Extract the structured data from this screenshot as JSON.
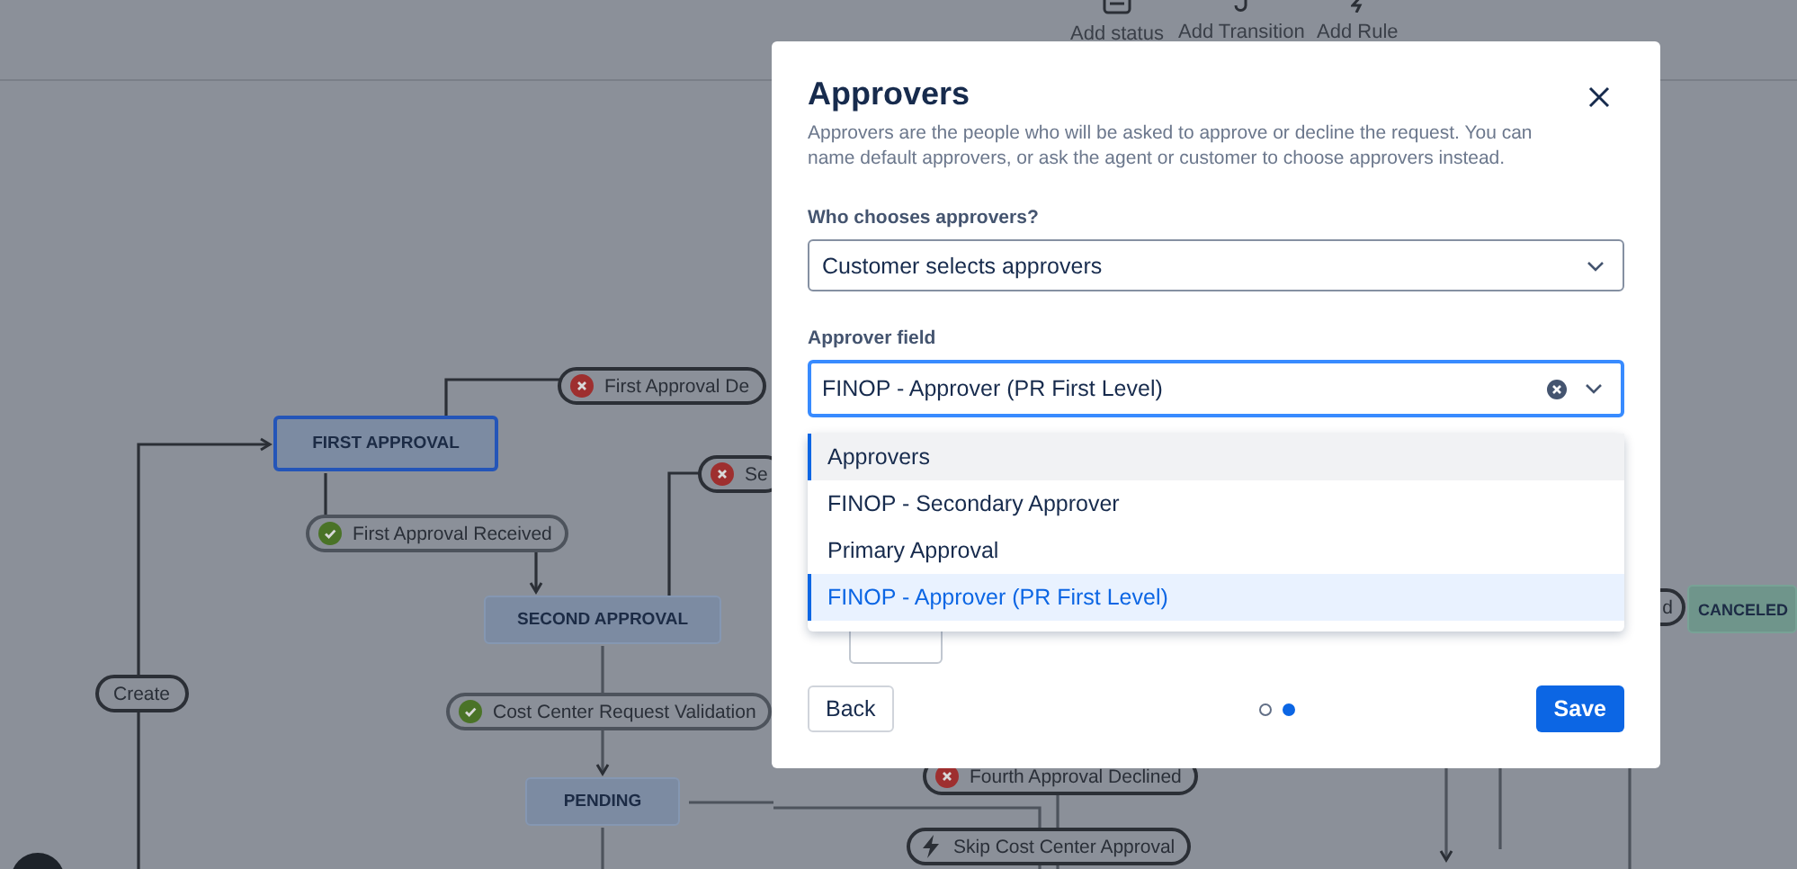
{
  "toolbar": [
    {
      "label": "Add status",
      "kind": "status"
    },
    {
      "label": "Add Transition",
      "kind": "transition"
    },
    {
      "label": "Add Rule",
      "kind": "rule"
    }
  ],
  "workflow": {
    "statuses": [
      {
        "label": "FIRST APPROVAL",
        "kind": "progress",
        "selected": true
      },
      {
        "label": "SECOND APPROVAL",
        "kind": "progress",
        "selected": false
      },
      {
        "label": "PENDING",
        "kind": "progress",
        "selected": false
      },
      {
        "label": "CANCELED",
        "kind": "done",
        "selected": false
      }
    ],
    "transitions": [
      {
        "label": "First Approval De",
        "kind": "declined"
      },
      {
        "label": "Se",
        "kind": "declined"
      },
      {
        "label": "First Approval Received",
        "kind": "approved"
      },
      {
        "label": "Create",
        "kind": "plain"
      },
      {
        "label": "Cost Center Request Validation",
        "kind": "approved"
      },
      {
        "label": "d",
        "kind": "plain"
      },
      {
        "label": "Fourth Approval Declined",
        "kind": "declined"
      },
      {
        "label": "Skip Cost Center Approval",
        "kind": "rule"
      }
    ]
  },
  "dialog": {
    "title": "Approvers",
    "description": "Approvers are the people who will be asked to approve or decline the request. You can name default approvers, or ask the agent or customer to choose approvers instead.",
    "who_chooses": {
      "label": "Who chooses approvers?",
      "value": "Customer selects approvers"
    },
    "approver_field": {
      "label": "Approver field",
      "value": "FINOP - Approver (PR First Level)",
      "options": [
        {
          "label": "Approvers",
          "highlighted": true,
          "selected": false
        },
        {
          "label": "FINOP - Secondary Approver",
          "highlighted": false,
          "selected": false
        },
        {
          "label": "Primary Approval",
          "highlighted": false,
          "selected": false
        },
        {
          "label": "FINOP - Approver (PR First Level)",
          "highlighted": false,
          "selected": true
        }
      ]
    },
    "steps": [
      {
        "selected": false
      },
      {
        "selected": true
      }
    ],
    "buttons": {
      "back": "Back",
      "save": "Save"
    }
  }
}
